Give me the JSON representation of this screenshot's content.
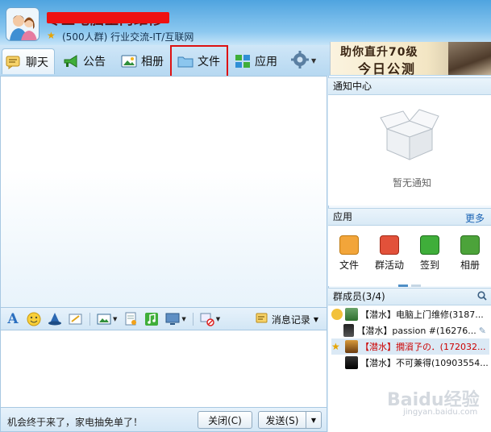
{
  "header": {
    "group_name": "专业电脑上门维修",
    "group_info": "(500人群) 行业交流-IT/互联网"
  },
  "tabs": [
    {
      "label": "聊天"
    },
    {
      "label": "公告"
    },
    {
      "label": "相册"
    },
    {
      "label": "文件"
    },
    {
      "label": "应用"
    }
  ],
  "banner": {
    "line1": "助你直升70级",
    "line2": "今日公测"
  },
  "input_toolbar": {
    "history_label": "消息记录"
  },
  "bottom": {
    "promo_text": "机会终于来了，家电抽免单了！",
    "close_label": "关闭(C)",
    "send_label": "发送(S)"
  },
  "notify": {
    "title": "通知中心",
    "empty_text": "暂无通知"
  },
  "apps": {
    "title": "应用",
    "more": "更多",
    "items": [
      {
        "label": "文件"
      },
      {
        "label": "群活动"
      },
      {
        "label": "签到"
      },
      {
        "label": "相册"
      }
    ]
  },
  "members": {
    "title": "群成员(3/4)",
    "list": [
      {
        "text": "【潜水】电脑上门维修(3187..."
      },
      {
        "text": "【潜水】passion #(16276..."
      },
      {
        "text": "【潜水】撊澬孒の．(172032..."
      },
      {
        "text": "【潜水】不可兼得(10903554..."
      }
    ]
  },
  "watermark": {
    "main": "Baidu经验",
    "sub": "jingyan.baidu.com"
  },
  "colors": {
    "header_blue": "#4fa4df",
    "highlight_red": "#dd1111",
    "link_blue": "#1a63b4",
    "red_member": "#cc0000"
  }
}
